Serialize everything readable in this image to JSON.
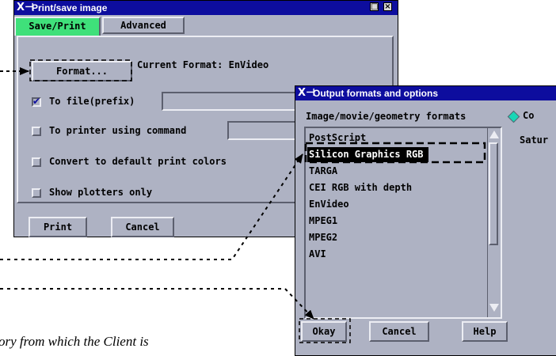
{
  "print_window": {
    "title": "Print/save image",
    "tabs": [
      {
        "label": "Save/Print",
        "active": true
      },
      {
        "label": "Advanced",
        "active": false
      }
    ],
    "format_button": "Format...",
    "current_format": "Current Format: EnVideo",
    "to_file": {
      "label": "To file(prefix)",
      "checked": true,
      "value": ""
    },
    "to_printer": {
      "label": "To printer using command",
      "checked": false,
      "value": ""
    },
    "convert_colors": {
      "label": "Convert to default print colors",
      "checked": false
    },
    "show_plotters": {
      "label": "Show plotters only",
      "checked": false
    },
    "print_button": "Print",
    "cancel_button": "Cancel"
  },
  "formats_window": {
    "title": "Output formats and options",
    "list_header": "Image/movie/geometry formats",
    "items": [
      "PostScript",
      "Silicon Graphics RGB",
      "TARGA",
      "CEI RGB with depth",
      "EnVideo",
      "MPEG1",
      "MPEG2",
      "AVI"
    ],
    "selected": "Silicon Graphics RGB",
    "radio_partial": "Co",
    "saturation_partial": "Satur",
    "okay_button": "Okay",
    "cancel_button": "Cancel",
    "help_button": "Help"
  },
  "caption": "ory from which the Client is",
  "colors": {
    "title_bar": "#0d0d9e",
    "active_tab": "#3fe07a",
    "panel": "#aeb2c3",
    "radio": "#19d6b6"
  }
}
